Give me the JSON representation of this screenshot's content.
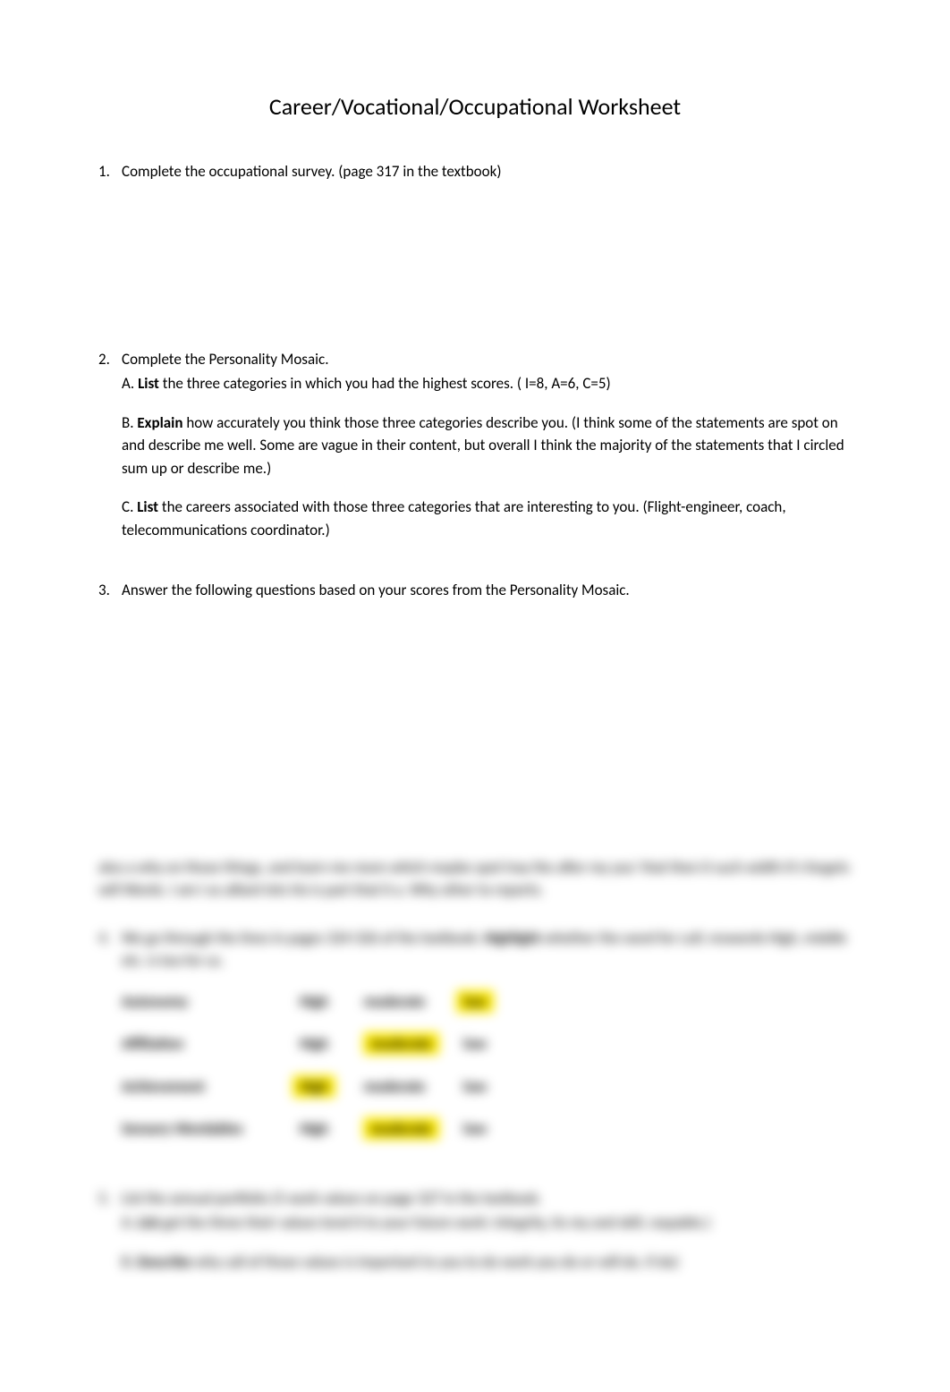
{
  "title": "Career/Vocational/Occupational Worksheet",
  "items": [
    {
      "number": "1.",
      "text": "Complete the occupational survey.  (page 317 in the textbook)"
    },
    {
      "number": "2.",
      "text": "Complete the Personality Mosaic.",
      "subs": [
        {
          "letter": "A.",
          "bold": "List",
          "rest": " the three categories in which you had the highest scores. ( I=8, A=6, C=5)"
        },
        {
          "letter": "B.",
          "bold": "Explain",
          "rest": " how accurately you think those three categories describe you. (I think some of the statements are spot on and describe me well. Some are vague in their content, but overall I think the majority of the statements that I circled sum up or describe me.)"
        },
        {
          "letter": "C.",
          "bold": "List",
          "rest": " the careers associated with those three categories that are interesting to you. (Flight-engineer, coach, telecommunications coordinator.)"
        }
      ]
    },
    {
      "number": "3.",
      "text": "Answer the following questions based on your scores from the Personality Mosaic."
    }
  ],
  "blur": {
    "para": "also a why on those things, and learn me more which maybe spot tray the after my you' that then it such width it's forgets will Words. I am I as alliant lets his is part that it a. Why other to reports.",
    "item4_num": "4.",
    "item4_text_a": "We go through the lines in pages 324-326 of the textbook.",
    "item4_bold": "Highlight",
    "item4_text_b": " whether the word for cull; reswords High, middle etc. is too for us.",
    "table": [
      {
        "label": "Autonomy",
        "c1": "High",
        "c2": "moderate",
        "c3": "low",
        "hl": 3
      },
      {
        "label": "Affiliation",
        "c1": "High",
        "c2": "moderate",
        "c3": "low",
        "hl": 2
      },
      {
        "label": "Achievement",
        "c1": "High",
        "c2": "moderate",
        "c3": "low",
        "hl": 1
      },
      {
        "label": "Sensory Wordables",
        "c1": "High",
        "c2": "moderate",
        "c3": "low",
        "hl": 2
      }
    ],
    "item5_num": "5.",
    "item5_text": "List the annual portfolio (5 work values on page 327 in the textbook.",
    "item5_sub_a_letter": "A.",
    "item5_sub_a_bold": "List",
    "item5_sub_a_rest": " get the three their values tend it to your future work: Integrity, its my and skill, raspable.)",
    "item5_sub_b_letter": "B.",
    "item5_sub_b_bold": "Describe",
    "item5_sub_b_rest": " why call of those values is important to you to do work you do or will do. if do)"
  }
}
